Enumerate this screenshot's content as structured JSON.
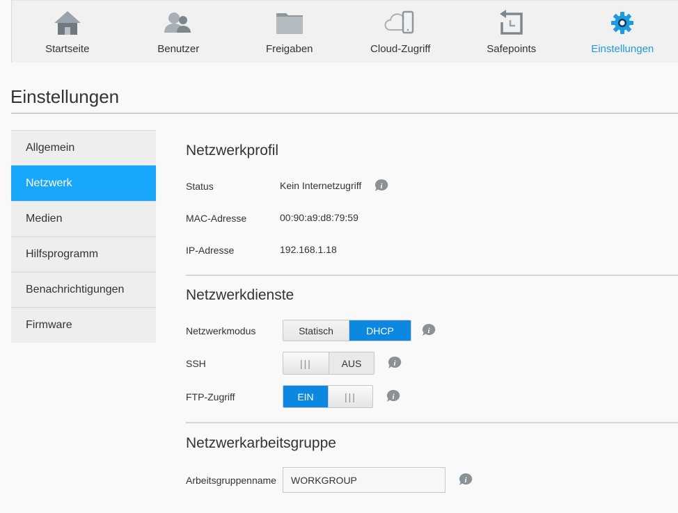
{
  "nav": {
    "items": [
      {
        "label": "Startseite",
        "icon": "home-icon"
      },
      {
        "label": "Benutzer",
        "icon": "users-icon"
      },
      {
        "label": "Freigaben",
        "icon": "folder-icon"
      },
      {
        "label": "Cloud-Zugriff",
        "icon": "cloud-device-icon"
      },
      {
        "label": "Safepoints",
        "icon": "safepoint-icon"
      },
      {
        "label": "Einstellungen",
        "icon": "gear-icon"
      }
    ],
    "active_color": "#1e9ae0"
  },
  "page": {
    "title": "Einstellungen"
  },
  "sidebar": {
    "items": [
      {
        "label": "Allgemein"
      },
      {
        "label": "Netzwerk"
      },
      {
        "label": "Medien"
      },
      {
        "label": "Hilfsprogramm"
      },
      {
        "label": "Benachrichtigungen"
      },
      {
        "label": "Firmware"
      }
    ],
    "active": "Netzwerk",
    "active_color": "#19a7fb"
  },
  "profile": {
    "title": "Netzwerkprofil",
    "status_label": "Status",
    "status_value": "Kein Internetzugriff",
    "mac_label": "MAC-Adresse",
    "mac_value": "00:90:a9:d8:79:59",
    "ip_label": "IP-Adresse",
    "ip_value": "192.168.1.18"
  },
  "services": {
    "title": "Netzwerkdienste",
    "mode_label": "Netzwerkmodus",
    "mode_options": [
      "Statisch",
      "DHCP"
    ],
    "mode_selected": "DHCP",
    "ssh_label": "SSH",
    "ssh_state": "AUS",
    "ftp_label": "FTP-Zugriff",
    "ftp_state": "EIN",
    "knob_glyph": "|||"
  },
  "workgroup": {
    "title": "Netzwerkarbeitsgruppe",
    "name_label": "Arbeitsgruppenname",
    "name_value": "WORKGROUP"
  },
  "colors": {
    "accent": "#0d88e0",
    "info_icon": "#8a9298"
  }
}
